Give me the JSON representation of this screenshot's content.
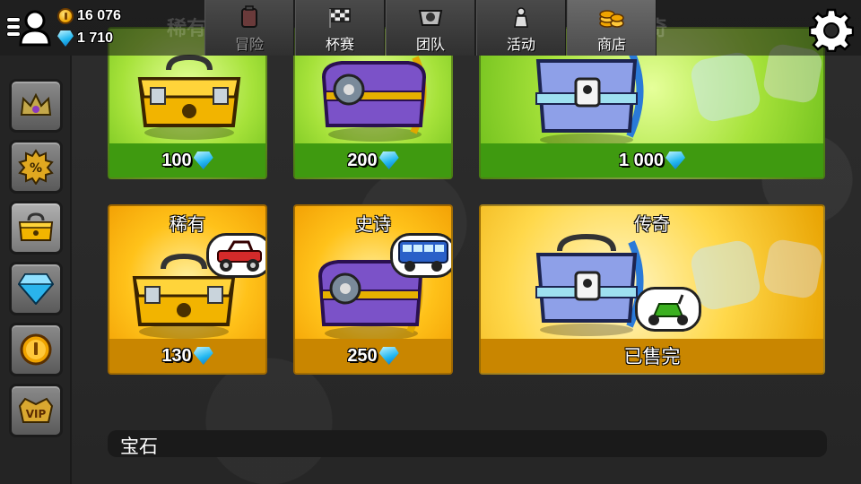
{
  "header": {
    "coins": "16 076",
    "gems": "1 710",
    "ghost_titles": [
      "稀有",
      "传奇"
    ],
    "tabs": [
      {
        "label": "冒险",
        "icon": "fuel-can-icon",
        "active": false
      },
      {
        "label": "杯赛",
        "icon": "checkered-flag-icon",
        "active": false
      },
      {
        "label": "团队",
        "icon": "team-emblem-icon",
        "active": false
      },
      {
        "label": "活动",
        "icon": "event-thumbs-icon",
        "active": false
      },
      {
        "label": "商店",
        "icon": "coin-stack-icon",
        "active": true
      }
    ]
  },
  "sidebar": {
    "items": [
      {
        "name": "crown-icon"
      },
      {
        "name": "discount-badge-icon"
      },
      {
        "name": "chest-icon",
        "active": true
      },
      {
        "name": "gem-icon"
      },
      {
        "name": "coin-icon"
      },
      {
        "name": "vip-icon",
        "label": "VIP"
      }
    ]
  },
  "top_row": [
    {
      "price": "100",
      "chest": "gold-chest"
    },
    {
      "price": "200",
      "chest": "purple-chest"
    },
    {
      "price": "1 000",
      "chest": "legendary-chest"
    }
  ],
  "bottom_row": [
    {
      "title": "稀有",
      "price": "130",
      "chest": "gold-chest",
      "vehicle": "red-jeep"
    },
    {
      "title": "史诗",
      "price": "250",
      "chest": "purple-chest",
      "vehicle": "blue-bus"
    },
    {
      "title": "传奇",
      "status": "已售完",
      "chest": "legendary-chest",
      "vehicle": "green-scooter"
    }
  ],
  "section": {
    "label": "宝石"
  },
  "colors": {
    "green_card": "#a6e23a",
    "orange_card": "#ffc21a",
    "gem_blue": "#23b8f0",
    "coin_gold": "#f0a400"
  }
}
